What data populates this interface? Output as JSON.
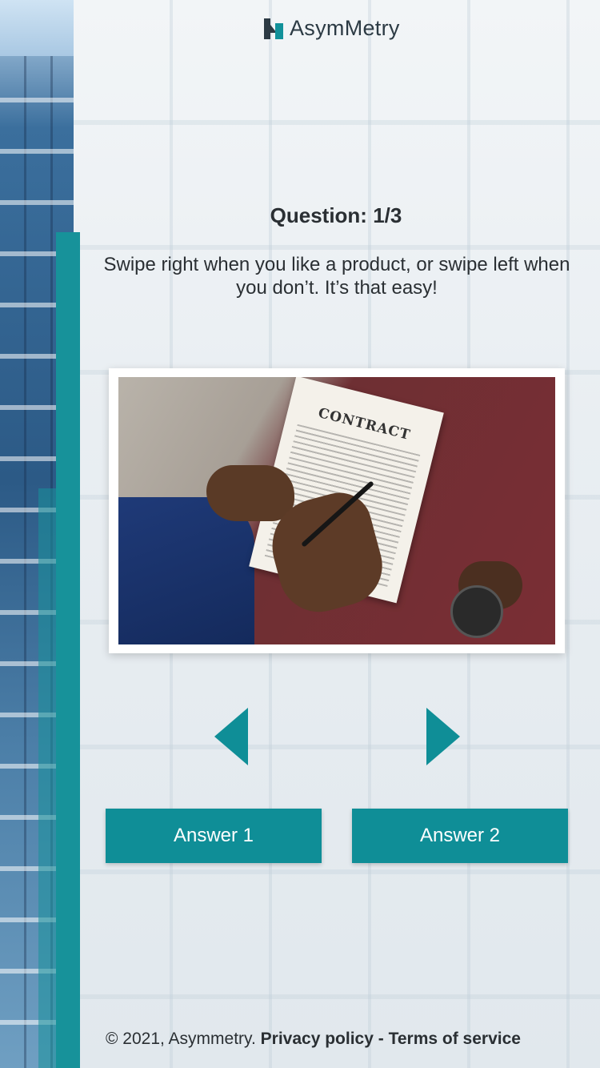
{
  "brand": {
    "name": "AsymMetry"
  },
  "question": {
    "label": "Question: 1/3"
  },
  "instructions": "Swipe right when you like a product, or swipe left when you don’t. It’s that easy!",
  "card": {
    "paper_title": "CONTRACT",
    "image_subject": "hands signing a contract document"
  },
  "nav": {
    "left_icon": "left-triangle-arrow",
    "right_icon": "right-triangle-arrow"
  },
  "answers": [
    {
      "label": "Answer 1"
    },
    {
      "label": "Answer 2"
    }
  ],
  "footer": {
    "copyright": "© 2021, Asymmetry.",
    "privacy": "Privacy policy",
    "separator": "-",
    "terms": "Terms of service"
  },
  "colors": {
    "accent": "#0f8e97",
    "text": "#2a2f33",
    "background": "#eef2f5"
  }
}
